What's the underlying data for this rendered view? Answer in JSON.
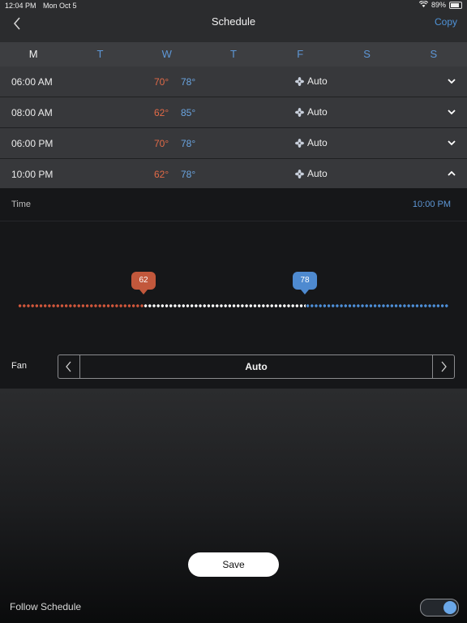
{
  "status_bar": {
    "time": "12:04 PM",
    "date": "Mon Oct 5",
    "battery": "89%"
  },
  "header": {
    "title": "Schedule",
    "copy_label": "Copy"
  },
  "days": [
    {
      "label": "M",
      "active": true
    },
    {
      "label": "T",
      "active": false
    },
    {
      "label": "W",
      "active": false
    },
    {
      "label": "T",
      "active": false
    },
    {
      "label": "F",
      "active": false
    },
    {
      "label": "S",
      "active": false
    },
    {
      "label": "S",
      "active": false
    }
  ],
  "schedule": [
    {
      "time": "06:00 AM",
      "heat": "70°",
      "cool": "78°",
      "fan": "Auto",
      "expanded": false
    },
    {
      "time": "08:00 AM",
      "heat": "62°",
      "cool": "85°",
      "fan": "Auto",
      "expanded": false
    },
    {
      "time": "06:00 PM",
      "heat": "70°",
      "cool": "78°",
      "fan": "Auto",
      "expanded": false
    },
    {
      "time": "10:00 PM",
      "heat": "62°",
      "cool": "78°",
      "fan": "Auto",
      "expanded": true
    }
  ],
  "detail": {
    "time_label": "Time",
    "time_value": "10:00 PM",
    "heat_setpoint": "62",
    "cool_setpoint": "78",
    "fan_label": "Fan",
    "fan_value": "Auto"
  },
  "footer": {
    "save_label": "Save",
    "follow_label": "Follow Schedule",
    "follow_on": true
  },
  "colors": {
    "heat": "#e16a47",
    "cool": "#5e97d6",
    "accent": "#4f93d8"
  }
}
